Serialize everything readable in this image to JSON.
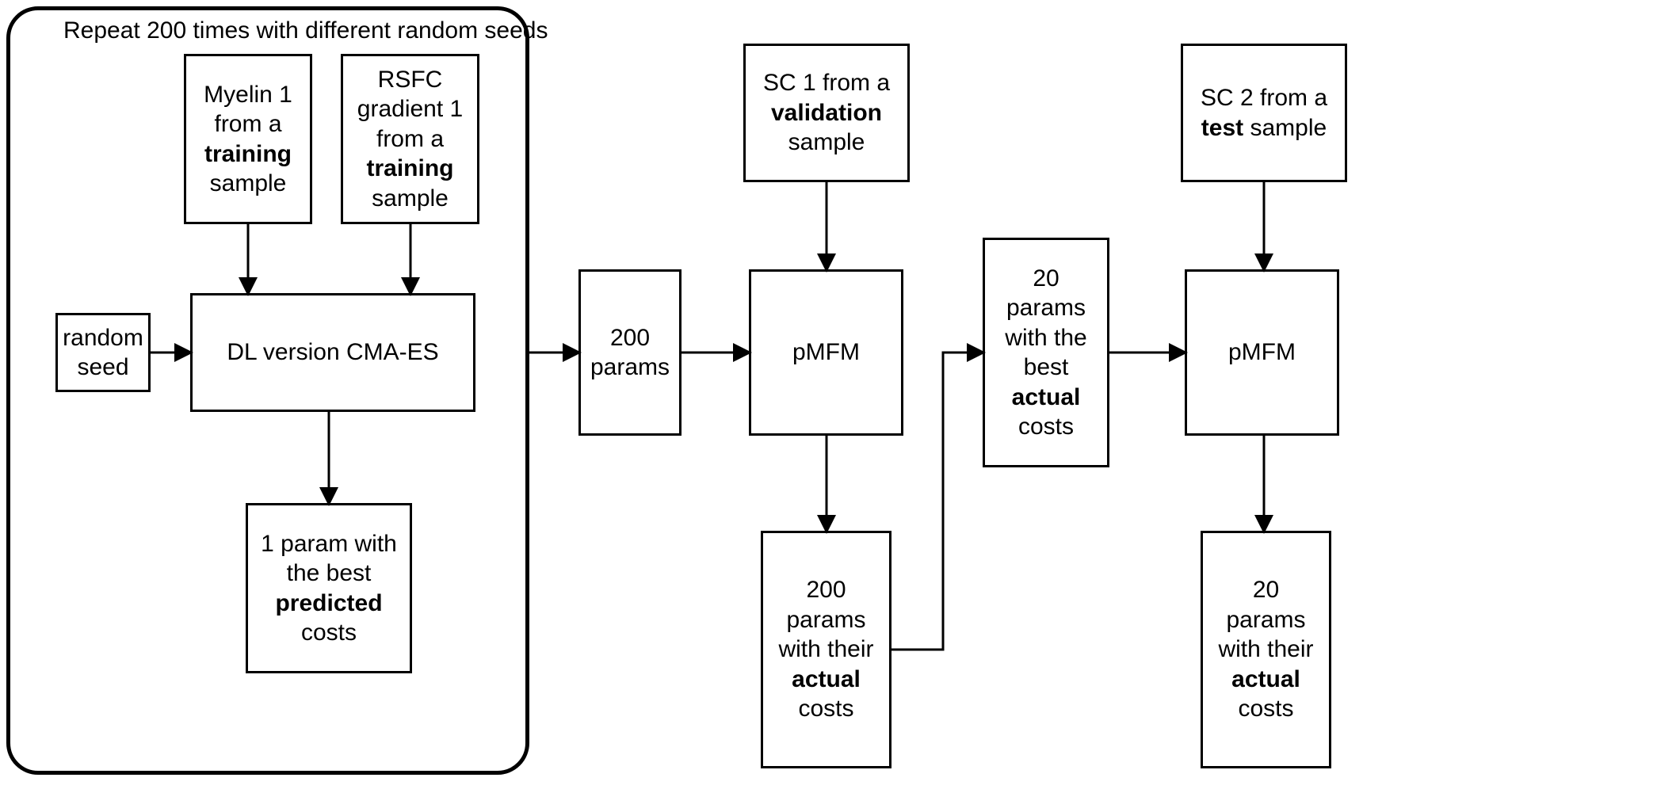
{
  "group": {
    "title": "Repeat 200 times with different random seeds"
  },
  "boxes": {
    "myelin": {
      "pre": "Myelin 1 from a ",
      "bold": "training",
      "post": " sample"
    },
    "rsfc": {
      "pre": "RSFC gradient 1 from a ",
      "bold": "training",
      "post": " sample"
    },
    "seed": {
      "text": "random seed"
    },
    "cmaes": {
      "text": "DL version CMA-ES"
    },
    "oneparam": {
      "pre": "1 param with the best ",
      "bold": "predicted",
      "post": " costs"
    },
    "p200": {
      "text": "200 params"
    },
    "sc1": {
      "pre": "SC 1 from a ",
      "bold": "validation",
      "post": " sample"
    },
    "pmfm1": {
      "text": "pMFM"
    },
    "p200out": {
      "pre": "200 params with their ",
      "bold": "actual",
      "post": " costs"
    },
    "p20": {
      "pre": "20 params with the best ",
      "bold": "actual",
      "post": " costs"
    },
    "sc2": {
      "pre": "SC 2 from a ",
      "bold": "test",
      "post": " sample"
    },
    "pmfm2": {
      "text": "pMFM"
    },
    "p20out": {
      "pre": "20 params with their ",
      "bold": "actual",
      "post": " costs"
    }
  }
}
